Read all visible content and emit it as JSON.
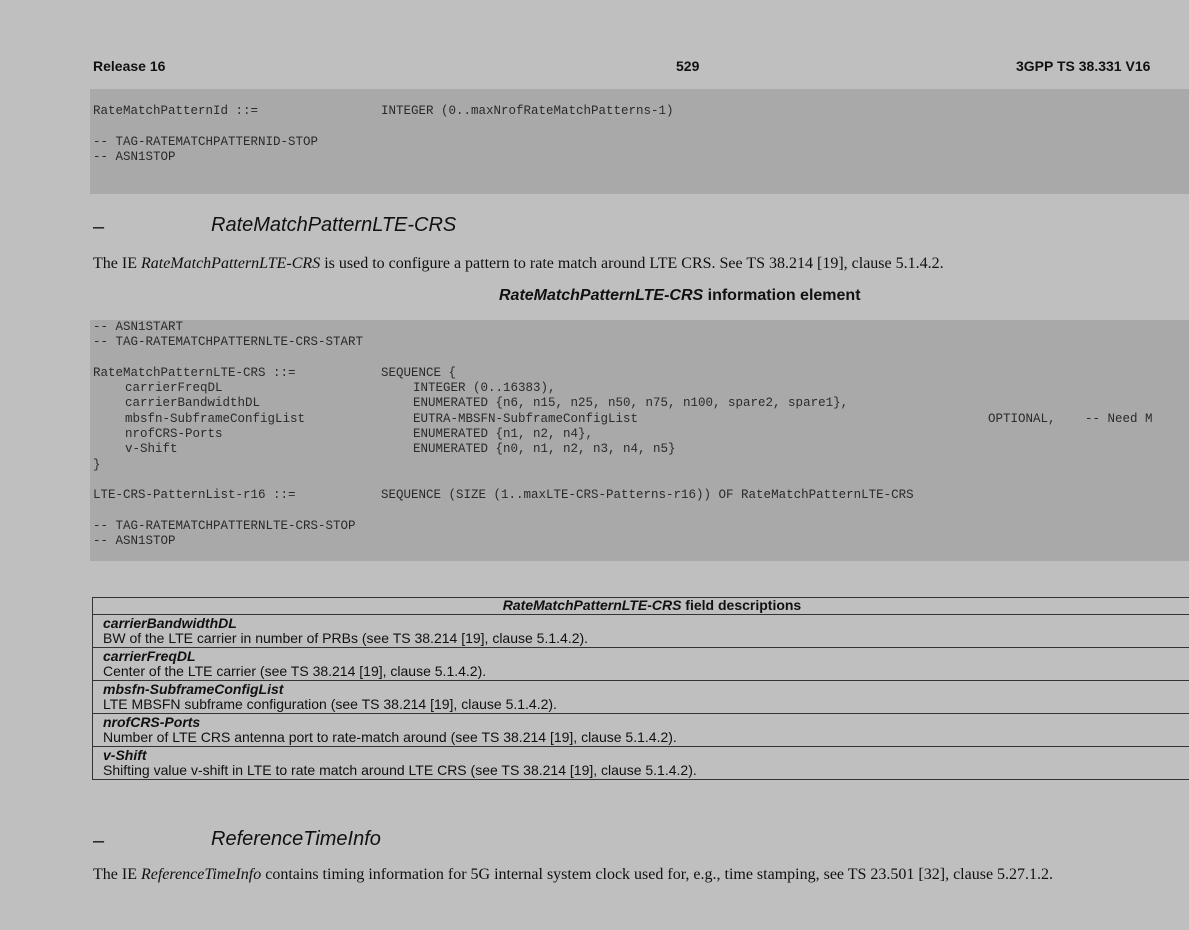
{
  "header": {
    "left": "Release 16",
    "center": "529",
    "right": "3GPP TS 38.331 V16"
  },
  "code_top": [
    [
      [
        "RateMatchPatternId ::=",
        ""
      ],
      [
        "INTEGER (0..maxNrofRateMatchPatterns-1)",
        ""
      ]
    ],
    null,
    [
      [
        "-- TAG-RATEMATCHPATTERNID-STOP",
        ""
      ]
    ],
    [
      [
        "-- ASN1STOP",
        ""
      ]
    ]
  ],
  "section1": {
    "dash": "–",
    "title": "RateMatchPatternLTE-CRS",
    "para_prefix": "The IE ",
    "para_ie": "RateMatchPatternLTE-CRS",
    "para_suffix": " is used to configure a pattern to rate match around LTE CRS. See TS 38.214 [19], clause 5.1.4.2.",
    "caption_italic": "RateMatchPatternLTE-CRS",
    "caption_rest": " information element"
  },
  "code_main": {
    "l1": "-- ASN1START",
    "l2": "-- TAG-RATEMATCHPATTERNLTE-CRS-START",
    "l4a": "RateMatchPatternLTE-CRS ::=",
    "l4b": "SEQUENCE {",
    "l5a": "carrierFreqDL",
    "l5b": "INTEGER (0..16383),",
    "l6a": "carrierBandwidthDL",
    "l6b": "ENUMERATED {n6, n15, n25, n50, n75, n100, spare2, spare1},",
    "l7a": "mbsfn-SubframeConfigList",
    "l7b": "EUTRA-MBSFN-SubframeConfigList",
    "l7c": "OPTIONAL,",
    "l7d": "-- Need M",
    "l8a": "nrofCRS-Ports",
    "l8b": "ENUMERATED {n1, n2, n4},",
    "l9a": "v-Shift",
    "l9b": "ENUMERATED {n0, n1, n2, n3, n4, n5}",
    "l10": "}",
    "l12a": "LTE-CRS-PatternList-r16 ::=",
    "l12b": "SEQUENCE (SIZE (1..maxLTE-CRS-Patterns-r16)) OF RateMatchPatternLTE-CRS",
    "l14": "-- TAG-RATEMATCHPATTERNLTE-CRS-STOP",
    "l15": "-- ASN1STOP"
  },
  "field_table": {
    "header_italic": "RateMatchPatternLTE-CRS",
    "header_rest": " field descriptions",
    "rows": [
      {
        "name": "carrierBandwidthDL",
        "desc": "BW of the LTE carrier in number of PRBs (see TS 38.214 [19], clause 5.1.4.2)."
      },
      {
        "name": "carrierFreqDL",
        "desc": "Center of the LTE carrier (see TS 38.214 [19], clause 5.1.4.2)."
      },
      {
        "name": "mbsfn-SubframeConfigList",
        "desc": "LTE MBSFN subframe configuration (see TS 38.214 [19], clause 5.1.4.2)."
      },
      {
        "name": "nrofCRS-Ports",
        "desc": "Number of LTE CRS antenna port to rate-match around (see TS 38.214 [19], clause 5.1.4.2)."
      },
      {
        "name": "v-Shift",
        "desc": "Shifting value v-shift in LTE to rate match around LTE CRS (see TS 38.214 [19], clause 5.1.4.2)."
      }
    ]
  },
  "section2": {
    "dash": "–",
    "title": "ReferenceTimeInfo",
    "para_prefix": "The IE ",
    "para_ie": "ReferenceTimeInfo",
    "para_suffix": " contains timing information for 5G internal system clock used for, e.g., time stamping, see TS 23.501 [32], clause 5.27.1.2."
  }
}
